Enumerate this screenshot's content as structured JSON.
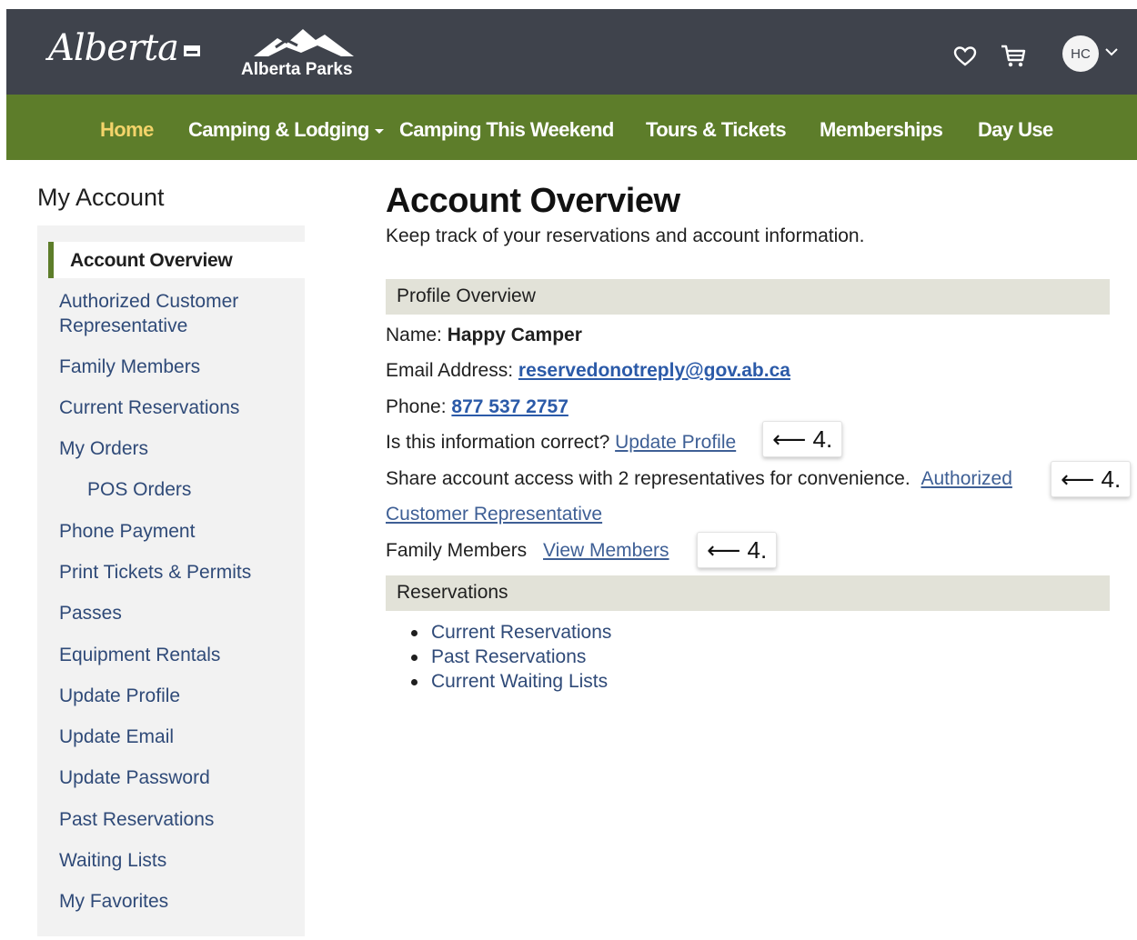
{
  "header": {
    "logo_text": "Alberta",
    "parks_logo_text": "Alberta Parks",
    "favorites_icon": "heart-icon",
    "cart_icon": "cart-icon",
    "avatar_initials": "HC",
    "colors": {
      "header_bg": "#3f434c",
      "nav_bg": "#5d7d2a",
      "nav_active": "#f3d46a"
    }
  },
  "nav": {
    "items": [
      {
        "label": "Home",
        "active": true
      },
      {
        "label": "Camping & Lodging",
        "has_dropdown": true
      },
      {
        "label": "Camping This Weekend"
      },
      {
        "label": "Tours & Tickets"
      },
      {
        "label": "Memberships"
      },
      {
        "label": "Day Use"
      }
    ]
  },
  "sidebar": {
    "title": "My Account",
    "active": "Account Overview",
    "items": [
      {
        "label": "Authorized Customer"
      },
      {
        "label": "Representative"
      },
      {
        "label": "Family Members"
      },
      {
        "label": "Current Reservations"
      },
      {
        "label": "My Orders"
      },
      {
        "label": "POS Orders"
      },
      {
        "label": "Phone Payment"
      },
      {
        "label": "Print Tickets & Permits"
      },
      {
        "label": "Passes"
      },
      {
        "label": "Equipment Rentals"
      },
      {
        "label": "Update Profile"
      },
      {
        "label": "Update Email"
      },
      {
        "label": "Update Password"
      },
      {
        "label": "Past Reservations"
      },
      {
        "label": "Waiting Lists"
      },
      {
        "label": "My Favorites"
      }
    ]
  },
  "main": {
    "title": "Account Overview",
    "subtitle": "Keep track of your reservations and account information.",
    "profile_section": "Profile Overview",
    "name_label": "Name:",
    "name_value": "Happy Camper",
    "email_label": "Email Address:",
    "email_value": "reservedonotreply@gov.ab.ca",
    "phone_label": "Phone:",
    "phone_value": "877 537 2757",
    "correct_question": "Is this information correct?",
    "update_profile_link": "Update Profile",
    "share_text": "Share account access with 2 representatives for convenience.",
    "authorized_link_1": "Authorized",
    "authorized_link_2": "Customer Representative",
    "family_label": "Family Members",
    "view_members_link": "View Members",
    "callout_text": "⟵ 4.",
    "reservations_section": "Reservations",
    "reservation_links": [
      "Current Reservations",
      "Past Reservations",
      "Current Waiting Lists"
    ]
  }
}
